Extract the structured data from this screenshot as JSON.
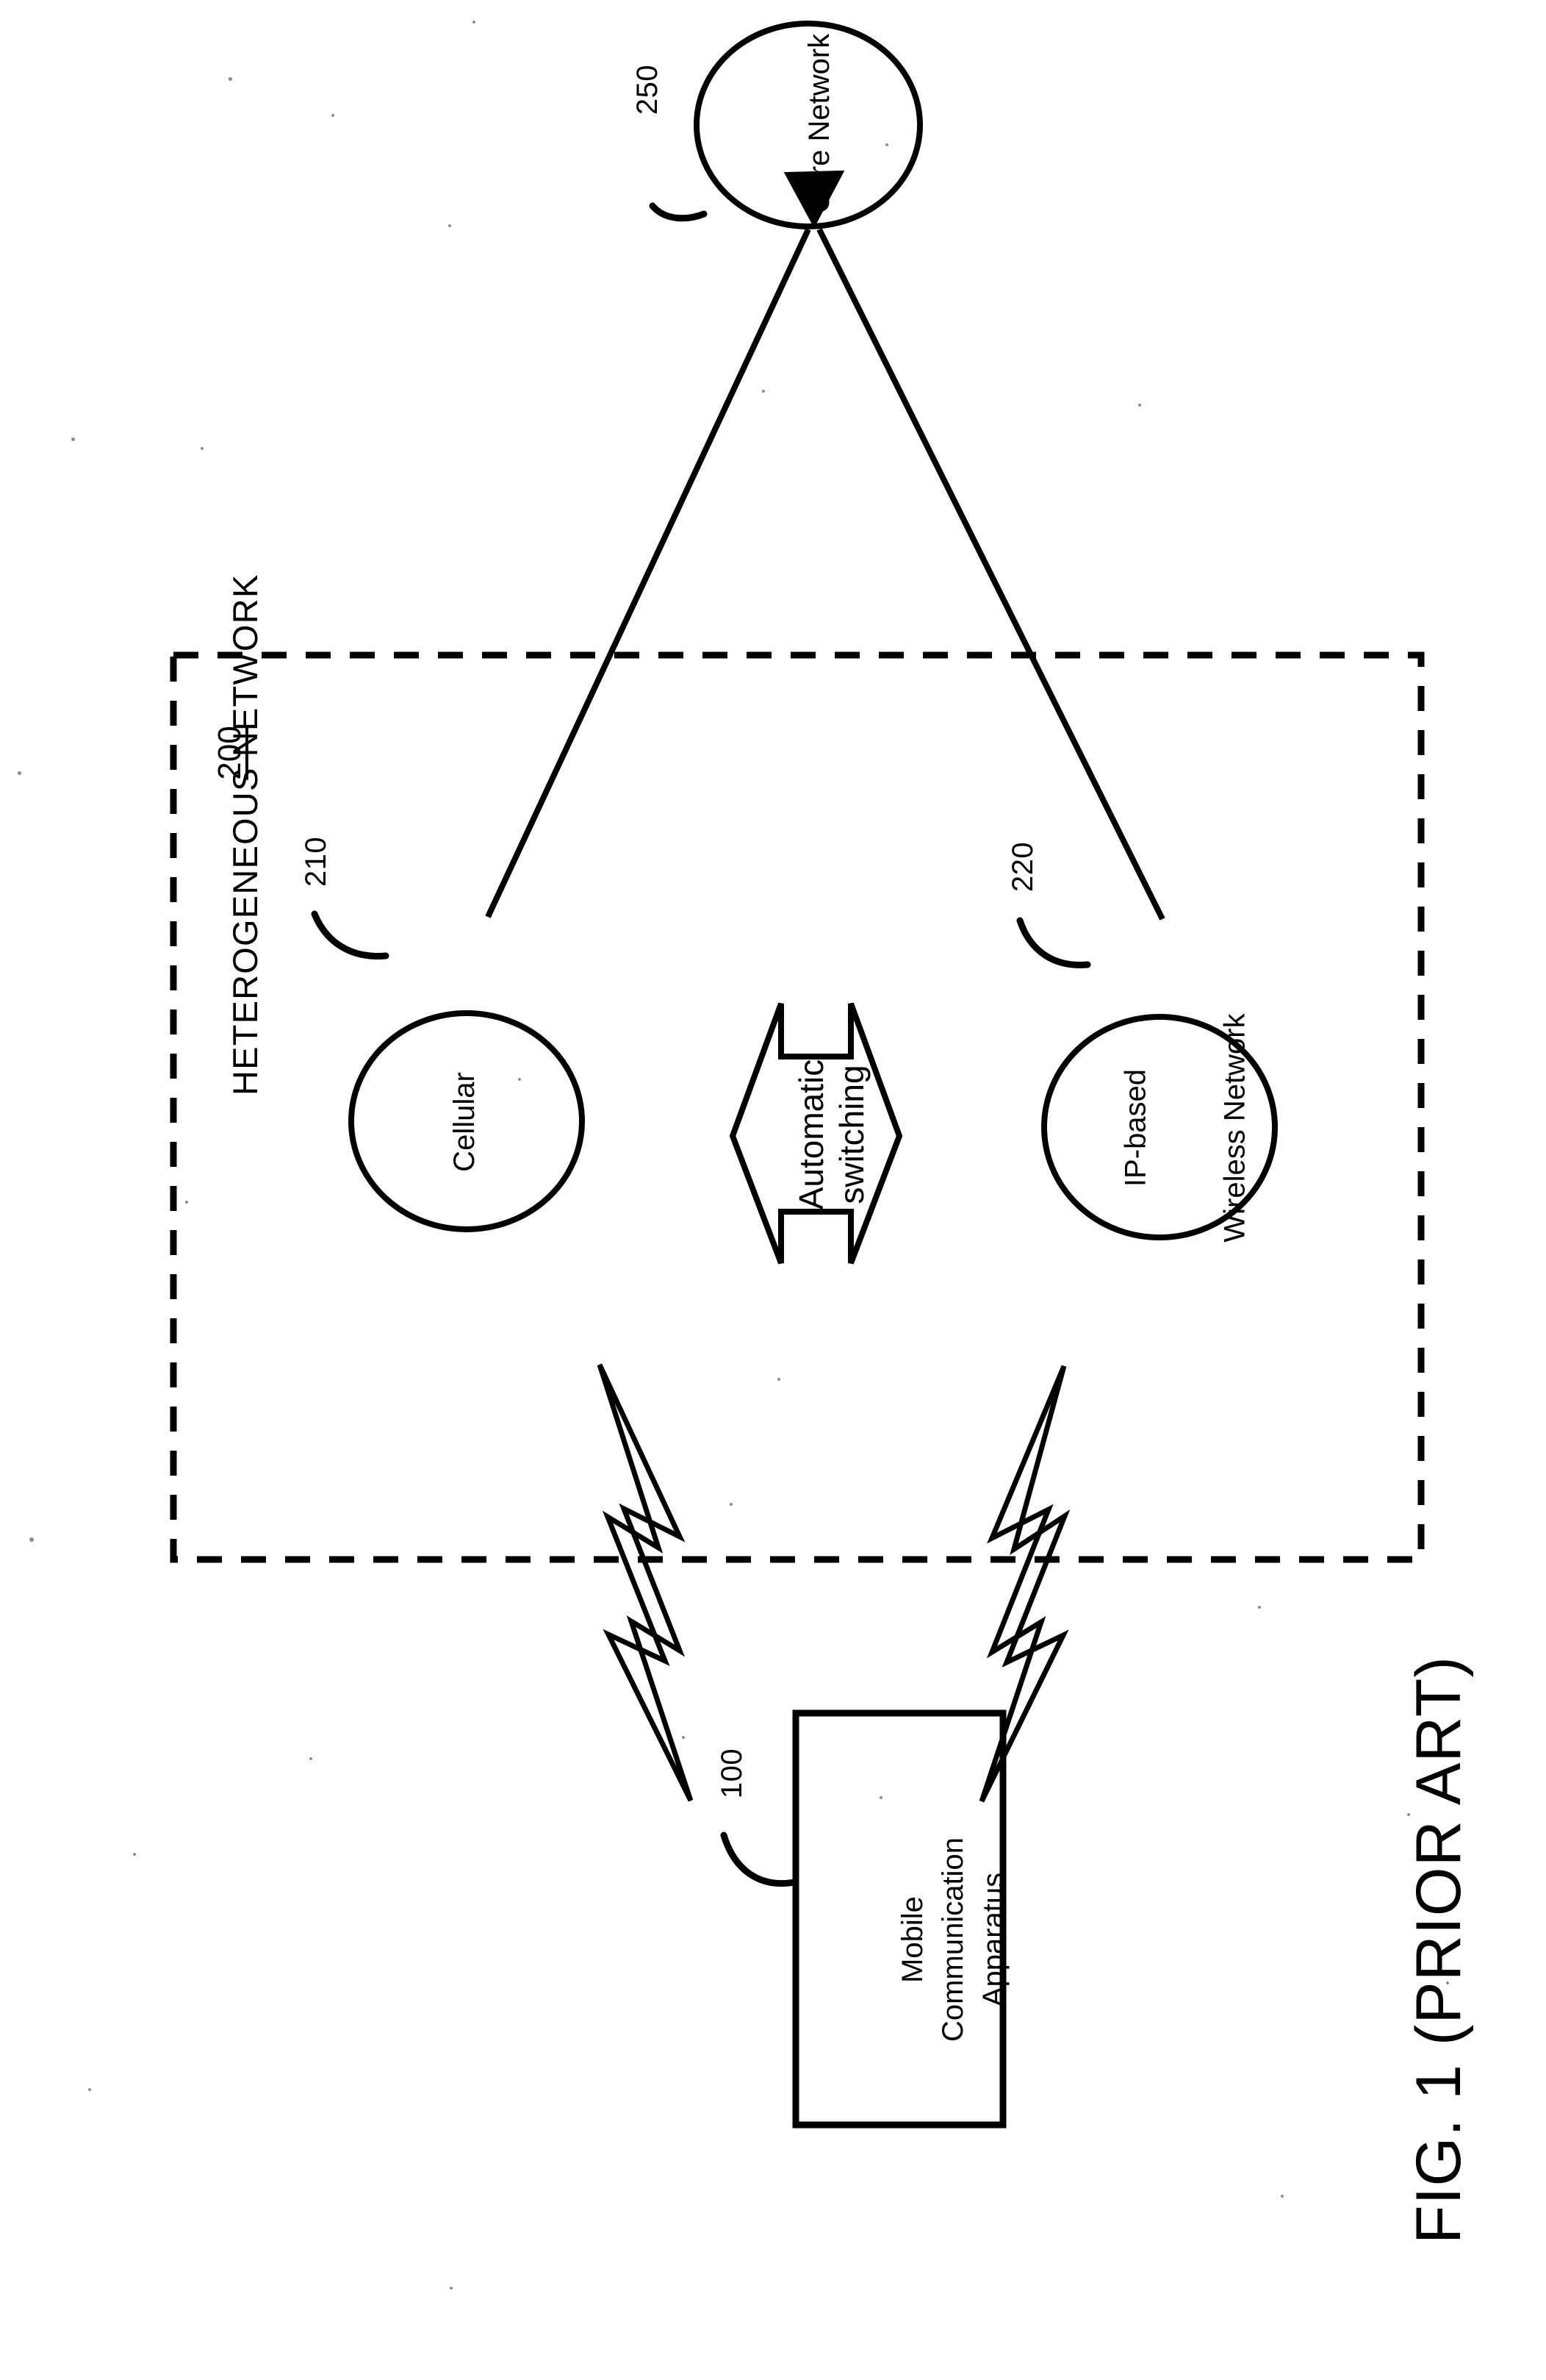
{
  "figure": {
    "caption": "FIG. 1 (PRIOR ART)",
    "sheet_orientation": "landscape-rotated-90"
  },
  "nodes": {
    "core_network": {
      "label": "Core Network",
      "ref": "250",
      "shape": "ellipse"
    },
    "cellular": {
      "label": "Cellular",
      "ref": "210",
      "shape": "ellipse"
    },
    "ip_wireless": {
      "label_line1": "IP-based",
      "label_line2": "Wireless Network",
      "ref": "220",
      "shape": "ellipse"
    },
    "mobile_apparatus": {
      "label_line1": "Mobile",
      "label_line2": "Communication",
      "label_line3": "Apparatus",
      "ref": "100",
      "shape": "rectangle"
    }
  },
  "group": {
    "title": "HETEROGENEOUS NETWORK",
    "ref": "200",
    "border": "dashed"
  },
  "connector": {
    "switch_arrow_line1": "Automatic",
    "switch_arrow_line2": "switching",
    "shape": "double-headed-arrow"
  },
  "links": [
    {
      "from": "cellular",
      "to": "core_network",
      "style": "solid-line-arrow"
    },
    {
      "from": "ip_wireless",
      "to": "core_network",
      "style": "solid-line-arrow"
    },
    {
      "from": "mobile_apparatus",
      "to": "cellular",
      "style": "lightning-bolt"
    },
    {
      "from": "mobile_apparatus",
      "to": "ip_wireless",
      "style": "lightning-bolt"
    }
  ],
  "colors": {
    "ink": "#000000",
    "paper": "#ffffff"
  }
}
